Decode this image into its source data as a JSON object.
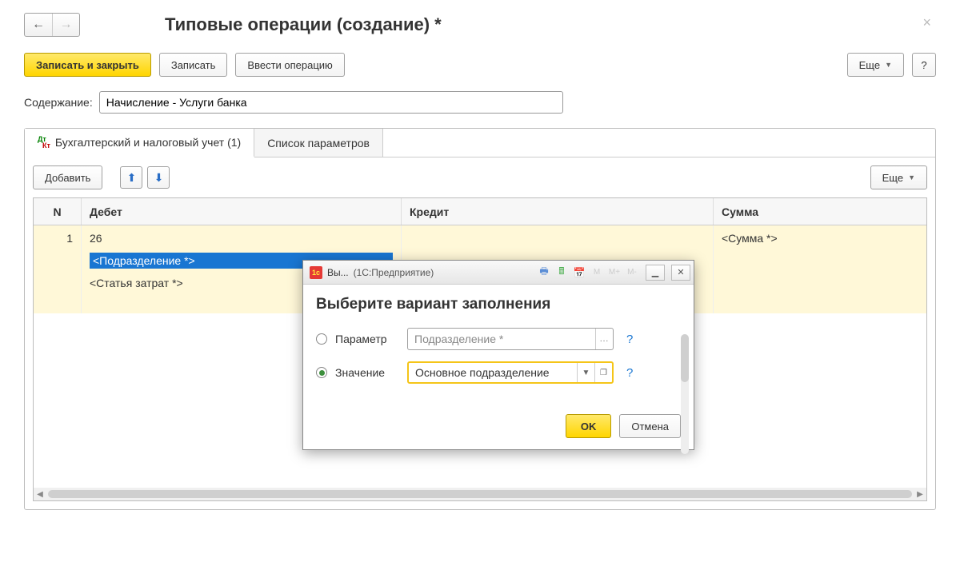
{
  "title": "Типовые операции (создание) *",
  "toolbar": {
    "save_close": "Записать и закрыть",
    "save": "Записать",
    "enter_op": "Ввести операцию",
    "more": "Еще",
    "help": "?"
  },
  "content_label": "Содержание:",
  "content_value": "Начисление - Услуги банка",
  "tabs": {
    "accounting": "Бухгалтерский и налоговый учет (1)",
    "params": "Список параметров"
  },
  "inner": {
    "add": "Добавить",
    "more": "Еще"
  },
  "grid": {
    "headers": {
      "n": "N",
      "debit": "Дебет",
      "credit": "Кредит",
      "sum": "Сумма"
    },
    "rows": [
      {
        "n": "1",
        "debit_account": "26",
        "debit_subdiv": "<Подразделение *>",
        "debit_cost": "<Статья затрат *>",
        "credit": "",
        "sum": "<Сумма *>"
      }
    ]
  },
  "modal": {
    "app_icon": "1c",
    "title": "Вы...",
    "title2": "(1С:Предприятие)",
    "heading": "Выберите вариант заполнения",
    "radio_param": "Параметр",
    "radio_value": "Значение",
    "param_placeholder": "Подразделение *",
    "value_text": "Основное подразделение",
    "m_labels": [
      "M",
      "M+",
      "M-"
    ],
    "ok": "OK",
    "cancel": "Отмена",
    "ellipsis": "...",
    "open_icon": "❐",
    "help": "?"
  }
}
